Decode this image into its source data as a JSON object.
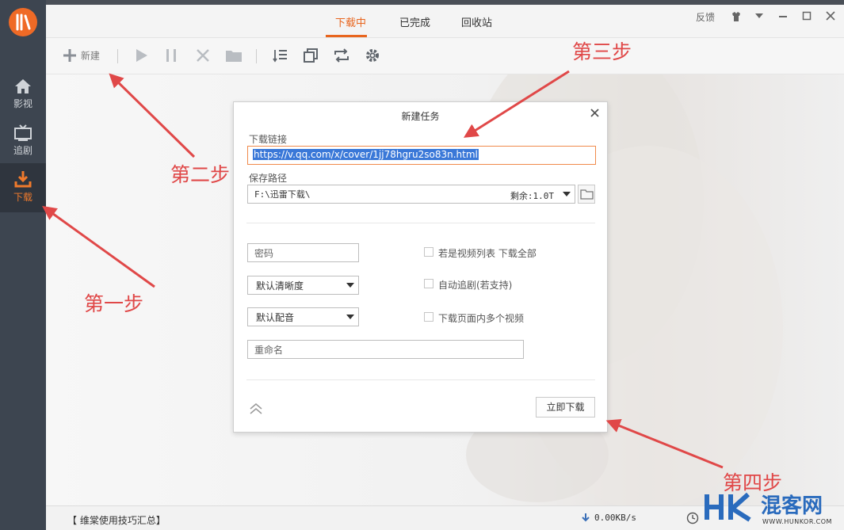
{
  "rail": {
    "items": [
      {
        "label": "影视"
      },
      {
        "label": "追剧"
      },
      {
        "label": "下载"
      }
    ]
  },
  "tabs": [
    {
      "label": "下载中"
    },
    {
      "label": "已完成"
    },
    {
      "label": "回收站"
    }
  ],
  "window_controls": {
    "feedback": "反馈"
  },
  "toolbar": {
    "new_label": "新建"
  },
  "dialog": {
    "title": "新建任务",
    "url_label": "下载链接",
    "url_value": "https://v.qq.com/x/cover/1jj78hgru2so83n.html",
    "path_label": "保存路径",
    "path_value": "F:\\迅雷下载\\",
    "remaining": "剩余:1.0T",
    "password_placeholder": "密码",
    "quality_select": "默认清晰度",
    "audio_select": "默认配音",
    "rename_placeholder": "重命名",
    "chk_all": "若是视频列表 下载全部",
    "chk_follow": "自动追剧(若支持)",
    "chk_multi": "下载页面内多个视频",
    "download_button": "立即下载"
  },
  "status": {
    "tips": "【 维棠使用技巧汇总】",
    "speed": "0.00KB/s"
  },
  "annotations": {
    "step1": "第一步",
    "step2": "第二步",
    "step3": "第三步",
    "step4": "第四步"
  },
  "watermark": {
    "brand": "混客网",
    "url": "WWW.HUNKOR.COM"
  },
  "colors": {
    "accent": "#e8651e",
    "annotation": "#e04848",
    "rail": "#3d4550"
  }
}
